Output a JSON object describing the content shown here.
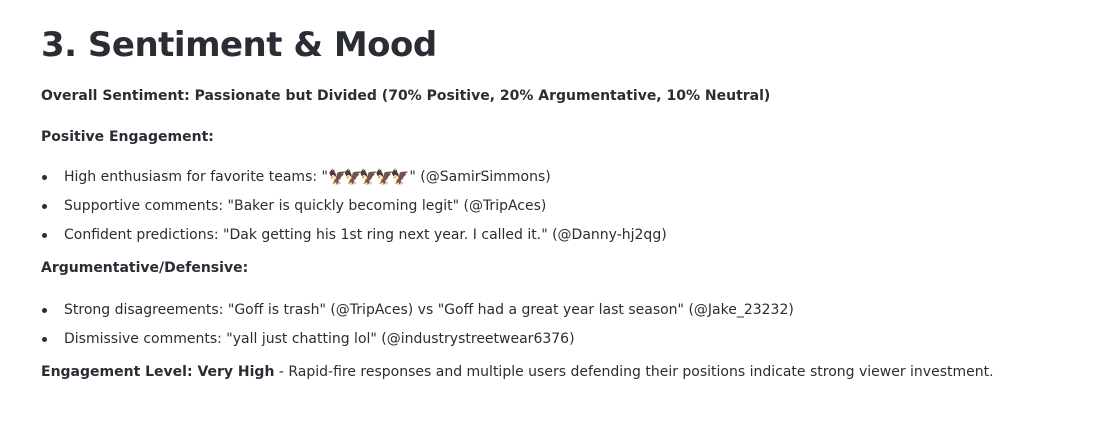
{
  "heading": "3. Sentiment & Mood",
  "overall": {
    "text": "Overall Sentiment: Passionate but Divided (70% Positive, 20% Argumentative, 10% Neutral)"
  },
  "positive": {
    "heading": "Positive Engagement:",
    "items": [
      {
        "before": "High enthusiasm for favorite teams: \"",
        "emoji": "🦅🦅🦅🦅🦅",
        "after": "\" (@SamirSimmons)"
      },
      {
        "text": "Supportive comments: \"Baker is quickly becoming legit\" (@TripAces)"
      },
      {
        "text": "Confident predictions: \"Dak getting his 1st ring next year. I called it.\" (@Danny-hj2qg)"
      }
    ]
  },
  "argumentative": {
    "heading": "Argumentative/Defensive:",
    "items": [
      {
        "text": "Strong disagreements: \"Goff is trash\" (@TripAces) vs \"Goff had a great year last season\" (@Jake_23232)"
      },
      {
        "text": "Dismissive comments: \"yall just chatting lol\" (@industrystreetwear6376)"
      }
    ]
  },
  "engagement": {
    "label": "Engagement Level: Very High",
    "text": " - Rapid-fire responses and multiple users defending their positions indicate strong viewer investment."
  }
}
